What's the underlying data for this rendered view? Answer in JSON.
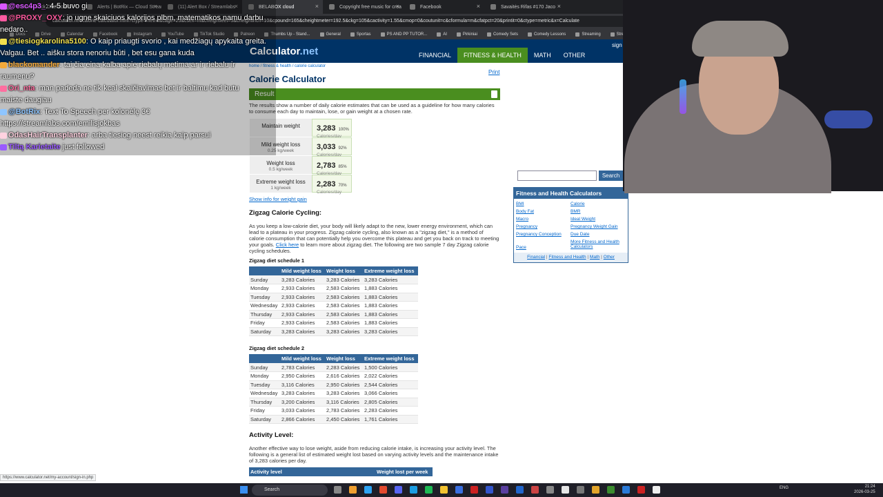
{
  "browser": {
    "tabs": [
      "Stream - Kick Dashboard",
      "Alerts | BotRix — Cloud Stream",
      "(11) Alert Box / Streamlabs",
      "BELABOX cloud",
      "Copyright free music for crea",
      "Facebook",
      "Savaitės Rifas #170 Jaco"
    ],
    "url": "calculator.net/calorie-calculator.html?ctype=metric&cage=25&csex=m&cheightfeet=5&cheightinch=10&cpound=165&cheightmeter=192.5&ckg=105&cactivity=1.55&cmop=0&coutunit=c&cformula=m&cfatpct=20&printit=0&ctype=metric&x=Calculate",
    "bookmarks": [
      "Docs",
      "Drive",
      "Calendar",
      "Facebook",
      "Instagram",
      "YouTube",
      "TikTok Studio",
      "Patreon",
      "Thumbs Up - Stand...",
      "General",
      "Sportas",
      "PS AND PP TUTOR...",
      "AI",
      "Pirkiniai",
      "Comedy Sets",
      "Comedy Lessons",
      "Streaming",
      "Stre"
    ]
  },
  "site": {
    "logo_main": "Calculator",
    "logo_tld": ".net",
    "nav": [
      "FINANCIAL",
      "FITNESS & HEALTH",
      "MATH",
      "OTHER"
    ],
    "signin": "sign",
    "breadcrumb": "home / fitness & health / calorie calculator",
    "print": "Print",
    "title": "Calorie Calculator",
    "result_header": "Result",
    "result_intro": "The results show a number of daily calorie estimates that can be used as a guideline for how many calories to consume each day to maintain, lose, or gain weight at a chosen rate.",
    "results": [
      {
        "label": "Maintain weight",
        "sub": "",
        "value": "3,283",
        "pct": "100%",
        "unit": "Calories/day"
      },
      {
        "label": "Mild weight loss",
        "sub": "0.25 kg/week",
        "value": "3,033",
        "pct": "92%",
        "unit": "Calories/day"
      },
      {
        "label": "Weight loss",
        "sub": "0.5 kg/week",
        "value": "2,783",
        "pct": "85%",
        "unit": "Calories/day"
      },
      {
        "label": "Extreme weight loss",
        "sub": "1 kg/week",
        "value": "2,283",
        "pct": "70%",
        "unit": "Calories/day"
      }
    ],
    "weight_gain_link": "Show info for weight gain",
    "zigzag_title": "Zigzag Calorie Cycling:",
    "zigzag_text_a": "As you keep a low-calorie diet, your body will likely adapt to the new, lower energy environment, which can lead to a plateau in your progress. Zigzag calorie cycling, also known as a \"zigzag diet,\" is a method of calorie consumption that can potentially help you overcome this plateau and get you back on track to meeting your goals. ",
    "zigzag_link": "Click here",
    "zigzag_text_b": " to learn more about zigzag diet. The following are two sample 7 day Zigzag calorie cycling schedules.",
    "schedule1_title": "Zigzag diet schedule 1",
    "schedule2_title": "Zigzag diet schedule 2",
    "schedule_headers": [
      "",
      "Mild weight loss",
      "Weight loss",
      "Extreme weight loss"
    ],
    "schedule1": [
      [
        "Sunday",
        "3,283 Calories",
        "3,283 Calories",
        "3,283 Calories"
      ],
      [
        "Monday",
        "2,933 Calories",
        "2,583 Calories",
        "1,883 Calories"
      ],
      [
        "Tuesday",
        "2,933 Calories",
        "2,583 Calories",
        "1,883 Calories"
      ],
      [
        "Wednesday",
        "2,933 Calories",
        "2,583 Calories",
        "1,883 Calories"
      ],
      [
        "Thursday",
        "2,933 Calories",
        "2,583 Calories",
        "1,883 Calories"
      ],
      [
        "Friday",
        "2,933 Calories",
        "2,583 Calories",
        "1,883 Calories"
      ],
      [
        "Saturday",
        "3,283 Calories",
        "3,283 Calories",
        "3,283 Calories"
      ]
    ],
    "schedule2": [
      [
        "Sunday",
        "2,783 Calories",
        "2,283 Calories",
        "1,500 Calories"
      ],
      [
        "Monday",
        "2,950 Calories",
        "2,616 Calories",
        "2,022 Calories"
      ],
      [
        "Tuesday",
        "3,116 Calories",
        "2,950 Calories",
        "2,544 Calories"
      ],
      [
        "Wednesday",
        "3,283 Calories",
        "3,283 Calories",
        "3,066 Calories"
      ],
      [
        "Thursday",
        "3,200 Calories",
        "3,116 Calories",
        "2,805 Calories"
      ],
      [
        "Friday",
        "3,033 Calories",
        "2,783 Calories",
        "2,283 Calories"
      ],
      [
        "Saturday",
        "2,866 Calories",
        "2,450 Calories",
        "1,761 Calories"
      ]
    ],
    "activity_title": "Activity Level:",
    "activity_text": "Another effective way to lose weight, aside from reducing calorie intake, is increasing your activity level. The following is a general list of estimated weight lost based on varying activity levels and the maintenance intake of 3,283 calories per day.",
    "activity_headers": [
      "Activity level",
      "Weight lost per week"
    ],
    "search_button": "Search",
    "fitness_box_title": "Fitness and Health Calculators",
    "fitness_links": [
      "BMI",
      "Calorie",
      "Body Fat",
      "BMR",
      "Macro",
      "Ideal Weight",
      "Pregnancy",
      "Pregnancy Weight Gain",
      "Pregnancy Conception",
      "Due Date",
      "Pace",
      "More Fitness and Health Calculators"
    ],
    "footer_links": [
      "Financial",
      "Fitness and Health",
      "Math",
      "Other"
    ],
    "status_link": "https://www.calculator.net/my-account/sign-in.php"
  },
  "chat": [
    {
      "user": "@esc4p3_",
      "text": ": 4-5 buvo gi",
      "color": "#d957ff"
    },
    {
      "user": "@PROXY_OXY",
      "text": ": jo ugne skaiciuos kalorijos plbm, matematikos namu darbu",
      "color": "#ff5aa0"
    },
    {
      "user": "",
      "text": "nedaro..",
      "color": "#ffffff"
    },
    {
      "user": "@tiesiogkarolina5100",
      "text": ": O kaip priaugti svorio , kai medžiagų apykaita greita.",
      "color": "#f2e04d"
    },
    {
      "user": "",
      "text": "Valgau. Bet .. aišku stora nenoriu būti , bet esu gana kuda",
      "color": "#ffffff"
    },
    {
      "user": "blackomander",
      "text": ": tai čia eina kalba apie riebalų metima ar ir riebalu ir",
      "color": "#f2a93b"
    },
    {
      "user": "",
      "text": "raumenu?",
      "color": "#ffffff"
    },
    {
      "user": "Ori_nta",
      "text": ": man padeda ne tik kcal skaičiavimas bet ir baltimu kad butu",
      "color": "#ff6fa0"
    },
    {
      "user": "",
      "text": "maiste daugiau",
      "color": "#ffffff"
    },
    {
      "user": "@BotRix",
      "text": ": Text To Speech per kolonėlę 3€",
      "color": "#8ec5ff"
    },
    {
      "user": "",
      "text": "https://streamlabs.com/emilisjokbas",
      "color": "#ffffff"
    },
    {
      "user": "OdasHairTransplanter",
      "text": ": arba tiesiog neest reikia kaip parsui",
      "color": "#ffd2e0"
    },
    {
      "user": "Tiltą Karietaite",
      "text": " just followed",
      "color": "#9a5bff"
    }
  ],
  "taskbar": {
    "search": "Search",
    "lang": "ENG",
    "time": "21:24",
    "date": "2026-03-25"
  }
}
